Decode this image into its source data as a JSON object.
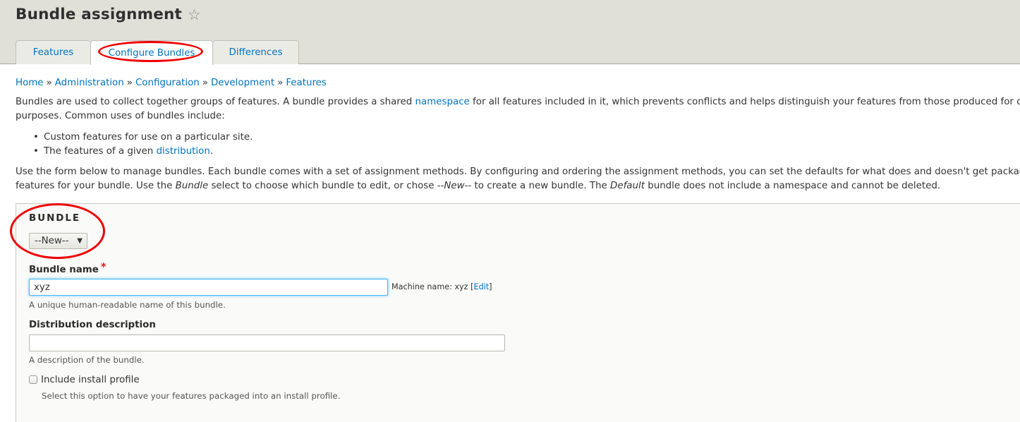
{
  "header": {
    "title": "Bundle assignment",
    "star_icon": "☆"
  },
  "tabs": [
    {
      "label": "Features",
      "active": false
    },
    {
      "label": "Configure Bundles",
      "active": true
    },
    {
      "label": "Differences",
      "active": false
    }
  ],
  "breadcrumb": {
    "items": [
      "Home",
      "Administration",
      "Configuration",
      "Development",
      "Features"
    ],
    "separator": "»"
  },
  "intro": {
    "line1_before": "Bundles are used to collect together groups of features. A bundle provides a shared ",
    "line1_link": "namespace",
    "line1_after": " for all features included in it, which prevents conflicts and helps distinguish your features from those produced for other",
    "line2": "purposes. Common uses of bundles include:",
    "bullets": [
      {
        "text": "Custom features for use on a particular site.",
        "link": "",
        "after": ""
      },
      {
        "text": "The features of a given ",
        "link": "distribution",
        "after": "."
      }
    ]
  },
  "usage": {
    "line1": "Use the form below to manage bundles. Each bundle comes with a set of assignment methods. By configuring and ordering the assignment methods, you can set the defaults for what does and doesn't get packaged int",
    "line2_a": "features for your bundle. Use the ",
    "line2_em1": "Bundle",
    "line2_b": " select to choose which bundle to edit, or chose --",
    "line2_em2": "New",
    "line2_c": "-- to create a new bundle. The ",
    "line2_em3": "Default",
    "line2_d": " bundle does not include a namespace and cannot be deleted."
  },
  "form": {
    "legend": "BUNDLE",
    "bundle_select": {
      "selected": "--New--",
      "arrow": "▼"
    },
    "bundle_name": {
      "label": "Bundle name",
      "required_mark": "*",
      "value": "xyz",
      "machine_name_prefix": "Machine name: xyz ",
      "machine_edit_open": "[",
      "machine_edit_link": "Edit",
      "machine_edit_close": "]",
      "description": "A unique human-readable name of this bundle."
    },
    "distribution_description": {
      "label": "Distribution description",
      "value": "",
      "description": "A description of the bundle."
    },
    "install_profile": {
      "label": "Include install profile",
      "checked": false,
      "description": "Select this option to have your features packaged into an install profile."
    }
  },
  "colors": {
    "link": "#0074bd",
    "header_bg": "#e0e0d8",
    "annotation": "#ee0000",
    "focus": "#40b6ff"
  }
}
